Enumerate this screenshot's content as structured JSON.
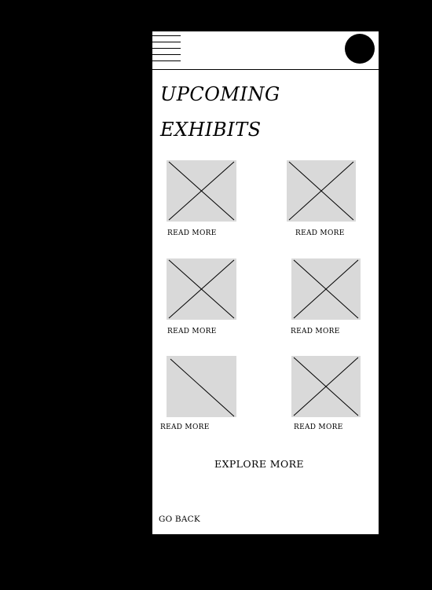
{
  "header": {
    "menu_icon": "hamburger-menu-icon",
    "avatar_icon": "profile-avatar"
  },
  "page": {
    "title_line_1": "UPCOMING",
    "title_line_2": "EXHIBITS"
  },
  "exhibits": [
    {
      "image": "image-placeholder",
      "link_label": "READ MORE"
    },
    {
      "image": "image-placeholder",
      "link_label": "READ MORE"
    },
    {
      "image": "image-placeholder",
      "link_label": "READ MORE"
    },
    {
      "image": "image-placeholder",
      "link_label": "READ MORE"
    },
    {
      "image": "image-placeholder",
      "link_label": "READ MORE"
    },
    {
      "image": "image-placeholder",
      "link_label": "READ MORE"
    }
  ],
  "actions": {
    "explore_more_label": "EXPLORE MORE",
    "go_back_label": "GO BACK"
  },
  "colors": {
    "background": "#000000",
    "screen": "#ffffff",
    "placeholder_fill": "#d9d9d9",
    "ink": "#000000"
  }
}
